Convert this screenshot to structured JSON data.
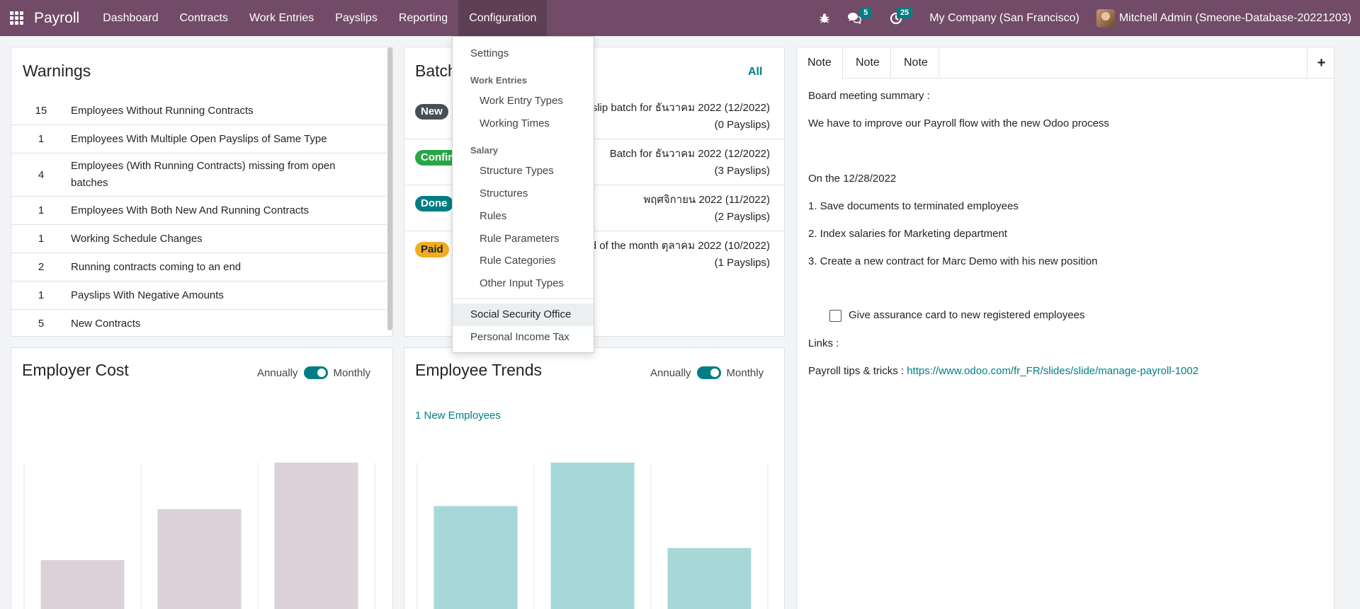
{
  "navbar": {
    "brand": "Payroll",
    "menu": [
      "Dashboard",
      "Contracts",
      "Work Entries",
      "Payslips",
      "Reporting",
      "Configuration"
    ],
    "messages_count": "5",
    "activities_count": "25",
    "company": "My Company (San Francisco)",
    "user": "Mitchell Admin (Smeone-Database-20221203)"
  },
  "warnings": {
    "title": "Warnings",
    "rows": [
      {
        "count": "15",
        "text": "Employees Without Running Contracts"
      },
      {
        "count": "1",
        "text": "Employees With Multiple Open Payslips of Same Type"
      },
      {
        "count": "4",
        "text": "Employees (With Running Contracts) missing from open batches"
      },
      {
        "count": "1",
        "text": "Employees With Both New And Running Contracts"
      },
      {
        "count": "1",
        "text": "Working Schedule Changes"
      },
      {
        "count": "2",
        "text": "Running contracts coming to an end"
      },
      {
        "count": "1",
        "text": "Payslips With Negative Amounts"
      },
      {
        "count": "5",
        "text": "New Contracts"
      }
    ]
  },
  "batches": {
    "title": "Batches",
    "all_label": "All",
    "rows": [
      {
        "state": "New",
        "name": "Payslip batch for ธันวาคม 2022 (12/2022)",
        "payslips": "(0 Payslips)"
      },
      {
        "state": "Confirmed",
        "name": "Batch for ธันวาคม 2022 (12/2022)",
        "payslips": "(3 Payslips)"
      },
      {
        "state": "Done",
        "name": "พฤศจิกายน 2022 (11/2022)",
        "payslips": "(2 Payslips)"
      },
      {
        "state": "Paid",
        "name": "End of the month ตุลาคม 2022 (10/2022)",
        "payslips": "(1 Payslips)"
      }
    ]
  },
  "notes": {
    "tabs": [
      "Note",
      "Note",
      "Note"
    ],
    "lines": {
      "summary": "Board meeting summary :",
      "improve": "We have to improve our Payroll flow with the new Odoo process",
      "date": "On the 12/28/2022",
      "item1": "1. Save documents to terminated employees",
      "item2": "2. Index salaries for Marketing department",
      "item3": "3. Create a new contract for Marc Demo with his new position",
      "checkbox": "Give assurance card to new registered employees",
      "links": "Links :",
      "tips_label": "Payroll tips & tricks : ",
      "tips_url": "https://www.odoo.com/fr_FR/slides/slide/manage-payroll-1002"
    }
  },
  "employer_cost": {
    "title": "Employer Cost",
    "toggle_left": "Annually",
    "toggle_right": "Monthly"
  },
  "employee_trends": {
    "title": "Employee Trends",
    "toggle_left": "Annually",
    "toggle_right": "Monthly",
    "new_employees": "1 New Employees"
  },
  "chart_data": [
    {
      "type": "bar",
      "title": "Employer Cost",
      "relative_values": [
        0.35,
        0.69,
        1.0
      ],
      "color": "#dcd0d9"
    },
    {
      "type": "bar",
      "title": "Employee Trends",
      "relative_values": [
        0.71,
        1.0,
        0.43
      ],
      "color": "#a7d8d8"
    }
  ],
  "config_menu": {
    "settings": "Settings",
    "work_entries_header": "Work Entries",
    "work_entry_types": "Work Entry Types",
    "working_times": "Working Times",
    "salary_header": "Salary",
    "structure_types": "Structure Types",
    "structures": "Structures",
    "rules": "Rules",
    "rule_parameters": "Rule Parameters",
    "rule_categories": "Rule Categories",
    "other_input_types": "Other Input Types",
    "social_security_office": "Social Security Office",
    "personal_income_tax": "Personal Income Tax"
  },
  "colors": {
    "navbar": "#714b67",
    "accent": "#017e84",
    "badge_new": "#4a4f55",
    "badge_confirmed": "#28a745",
    "badge_done": "#017e84",
    "badge_paid": "#f0ad1f"
  }
}
